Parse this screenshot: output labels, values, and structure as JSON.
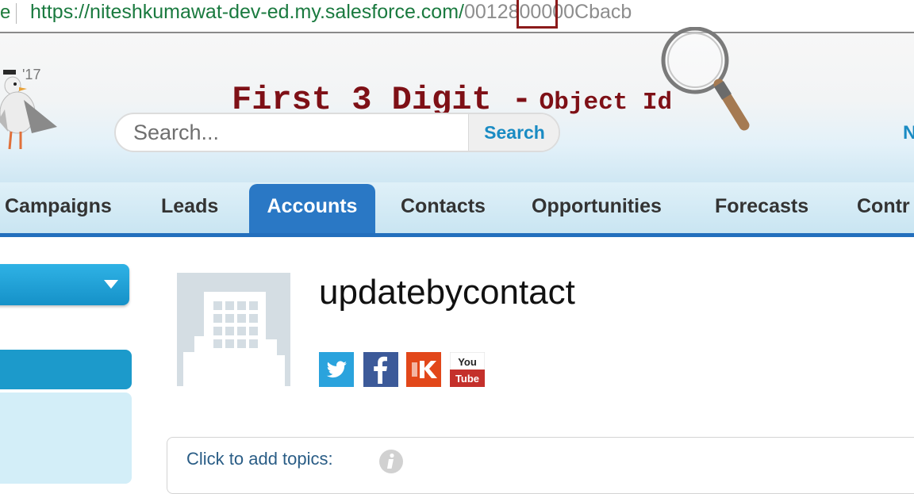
{
  "browser": {
    "url_prefix": "https://niteshkumawat-dev-ed.my.salesforce.com/",
    "url_id_prefix": "001",
    "url_id_rest": "2800000Cbacb",
    "edge_char": "e"
  },
  "header": {
    "logo_year": "'17",
    "annotation": {
      "main": "First 3 Digit -",
      "sub": "Object Id"
    },
    "search": {
      "placeholder": "Search...",
      "button_label": "Search"
    },
    "right_initial": "N"
  },
  "tabs": [
    {
      "label": "Campaigns"
    },
    {
      "label": "Leads"
    },
    {
      "label": "Accounts",
      "active": true
    },
    {
      "label": "Contacts"
    },
    {
      "label": "Opportunities"
    },
    {
      "label": "Forecasts"
    },
    {
      "label": "Contr"
    }
  ],
  "record": {
    "title": "updatebycontact",
    "social": [
      {
        "icon": "twitter-icon"
      },
      {
        "icon": "facebook-icon"
      },
      {
        "icon": "klout-icon"
      },
      {
        "icon": "youtube-icon",
        "label_line1": "You",
        "label_line2": "Tube"
      }
    ],
    "topics_label": "Click to add topics:"
  },
  "colors": {
    "annotation": "#7e1016",
    "highlight_box": "#8b1a1a",
    "active_tab": "#2a78c5",
    "link_blue": "#1a8bc3",
    "url_green": "#1a7a3f"
  }
}
